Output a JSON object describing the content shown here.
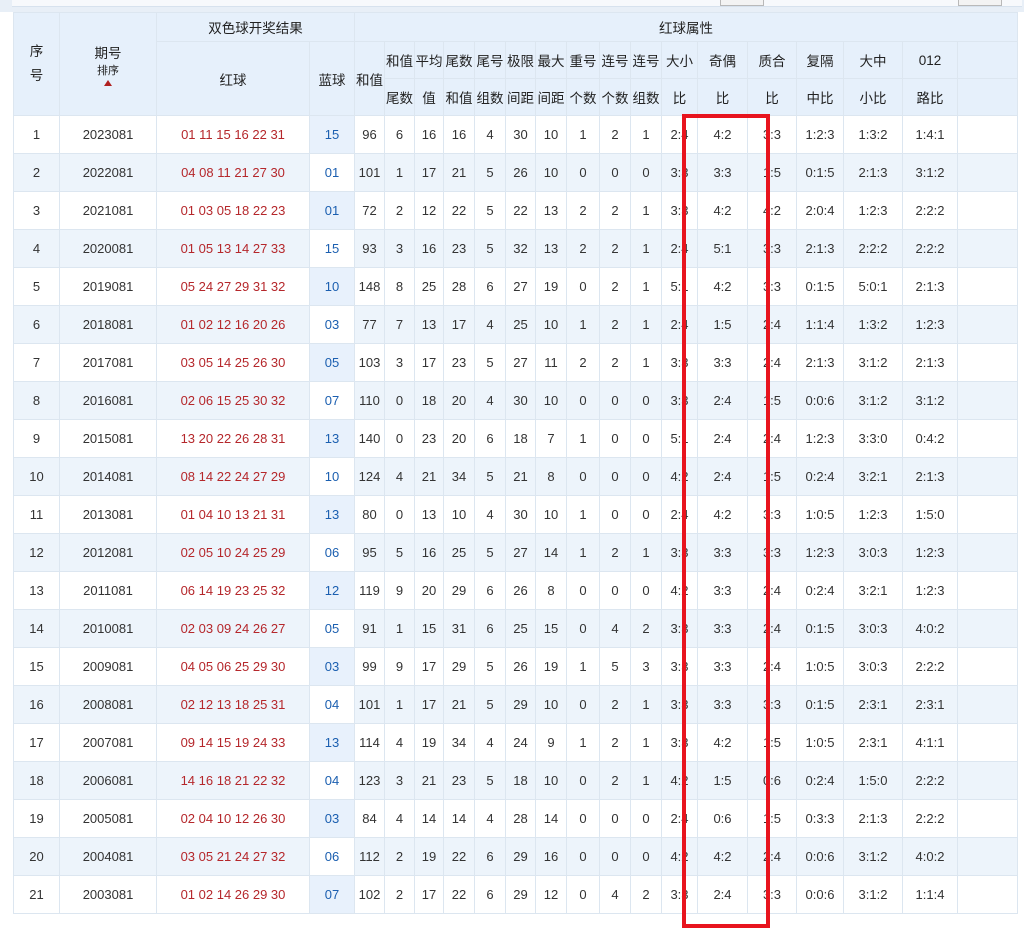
{
  "header": {
    "seq": "序号",
    "period": "期号",
    "sort": "排序",
    "result_group": "双色球开奖结果",
    "red_group": "红球属性",
    "red": "红球",
    "blue": "蓝球",
    "cols": [
      "和值",
      "和值尾数",
      "平均值",
      "尾数和值",
      "尾号组数",
      "极限间距",
      "最大间距",
      "重号个数",
      "连号个数",
      "连号组数",
      "大小比",
      "奇偶比",
      "质合比",
      "复隔中比",
      "大中小比",
      "012路比"
    ]
  },
  "rows": [
    [
      "1",
      "2023081",
      "01 11 15 16 22 31",
      "15",
      "96",
      "6",
      "16",
      "16",
      "4",
      "30",
      "10",
      "1",
      "2",
      "1",
      "2:4",
      "4:2",
      "3:3",
      "1:2:3",
      "1:3:2",
      "1:4:1"
    ],
    [
      "2",
      "2022081",
      "04 08 11 21 27 30",
      "01",
      "101",
      "1",
      "17",
      "21",
      "5",
      "26",
      "10",
      "0",
      "0",
      "0",
      "3:3",
      "3:3",
      "1:5",
      "0:1:5",
      "2:1:3",
      "3:1:2"
    ],
    [
      "3",
      "2021081",
      "01 03 05 18 22 23",
      "01",
      "72",
      "2",
      "12",
      "22",
      "5",
      "22",
      "13",
      "2",
      "2",
      "1",
      "3:3",
      "4:2",
      "4:2",
      "2:0:4",
      "1:2:3",
      "2:2:2"
    ],
    [
      "4",
      "2020081",
      "01 05 13 14 27 33",
      "15",
      "93",
      "3",
      "16",
      "23",
      "5",
      "32",
      "13",
      "2",
      "2",
      "1",
      "2:4",
      "5:1",
      "3:3",
      "2:1:3",
      "2:2:2",
      "2:2:2"
    ],
    [
      "5",
      "2019081",
      "05 24 27 29 31 32",
      "10",
      "148",
      "8",
      "25",
      "28",
      "6",
      "27",
      "19",
      "0",
      "2",
      "1",
      "5:1",
      "4:2",
      "3:3",
      "0:1:5",
      "5:0:1",
      "2:1:3"
    ],
    [
      "6",
      "2018081",
      "01 02 12 16 20 26",
      "03",
      "77",
      "7",
      "13",
      "17",
      "4",
      "25",
      "10",
      "1",
      "2",
      "1",
      "2:4",
      "1:5",
      "2:4",
      "1:1:4",
      "1:3:2",
      "1:2:3"
    ],
    [
      "7",
      "2017081",
      "03 05 14 25 26 30",
      "05",
      "103",
      "3",
      "17",
      "23",
      "5",
      "27",
      "11",
      "2",
      "2",
      "1",
      "3:3",
      "3:3",
      "2:4",
      "2:1:3",
      "3:1:2",
      "2:1:3"
    ],
    [
      "8",
      "2016081",
      "02 06 15 25 30 32",
      "07",
      "110",
      "0",
      "18",
      "20",
      "4",
      "30",
      "10",
      "0",
      "0",
      "0",
      "3:3",
      "2:4",
      "1:5",
      "0:0:6",
      "3:1:2",
      "3:1:2"
    ],
    [
      "9",
      "2015081",
      "13 20 22 26 28 31",
      "13",
      "140",
      "0",
      "23",
      "20",
      "6",
      "18",
      "7",
      "1",
      "0",
      "0",
      "5:1",
      "2:4",
      "2:4",
      "1:2:3",
      "3:3:0",
      "0:4:2"
    ],
    [
      "10",
      "2014081",
      "08 14 22 24 27 29",
      "10",
      "124",
      "4",
      "21",
      "34",
      "5",
      "21",
      "8",
      "0",
      "0",
      "0",
      "4:2",
      "2:4",
      "1:5",
      "0:2:4",
      "3:2:1",
      "2:1:3"
    ],
    [
      "11",
      "2013081",
      "01 04 10 13 21 31",
      "13",
      "80",
      "0",
      "13",
      "10",
      "4",
      "30",
      "10",
      "1",
      "0",
      "0",
      "2:4",
      "4:2",
      "3:3",
      "1:0:5",
      "1:2:3",
      "1:5:0"
    ],
    [
      "12",
      "2012081",
      "02 05 10 24 25 29",
      "06",
      "95",
      "5",
      "16",
      "25",
      "5",
      "27",
      "14",
      "1",
      "2",
      "1",
      "3:3",
      "3:3",
      "3:3",
      "1:2:3",
      "3:0:3",
      "1:2:3"
    ],
    [
      "13",
      "2011081",
      "06 14 19 23 25 32",
      "12",
      "119",
      "9",
      "20",
      "29",
      "6",
      "26",
      "8",
      "0",
      "0",
      "0",
      "4:2",
      "3:3",
      "2:4",
      "0:2:4",
      "3:2:1",
      "1:2:3"
    ],
    [
      "14",
      "2010081",
      "02 03 09 24 26 27",
      "05",
      "91",
      "1",
      "15",
      "31",
      "6",
      "25",
      "15",
      "0",
      "4",
      "2",
      "3:3",
      "3:3",
      "2:4",
      "0:1:5",
      "3:0:3",
      "4:0:2"
    ],
    [
      "15",
      "2009081",
      "04 05 06 25 29 30",
      "03",
      "99",
      "9",
      "17",
      "29",
      "5",
      "26",
      "19",
      "1",
      "5",
      "3",
      "3:3",
      "3:3",
      "2:4",
      "1:0:5",
      "3:0:3",
      "2:2:2"
    ],
    [
      "16",
      "2008081",
      "02 12 13 18 25 31",
      "04",
      "101",
      "1",
      "17",
      "21",
      "5",
      "29",
      "10",
      "0",
      "2",
      "1",
      "3:3",
      "3:3",
      "3:3",
      "0:1:5",
      "2:3:1",
      "2:3:1"
    ],
    [
      "17",
      "2007081",
      "09 14 15 19 24 33",
      "13",
      "114",
      "4",
      "19",
      "34",
      "4",
      "24",
      "9",
      "1",
      "2",
      "1",
      "3:3",
      "4:2",
      "1:5",
      "1:0:5",
      "2:3:1",
      "4:1:1"
    ],
    [
      "18",
      "2006081",
      "14 16 18 21 22 32",
      "04",
      "123",
      "3",
      "21",
      "23",
      "5",
      "18",
      "10",
      "0",
      "2",
      "1",
      "4:2",
      "1:5",
      "0:6",
      "0:2:4",
      "1:5:0",
      "2:2:2"
    ],
    [
      "19",
      "2005081",
      "02 04 10 12 26 30",
      "03",
      "84",
      "4",
      "14",
      "14",
      "4",
      "28",
      "14",
      "0",
      "0",
      "0",
      "2:4",
      "0:6",
      "1:5",
      "0:3:3",
      "2:1:3",
      "2:2:2"
    ],
    [
      "20",
      "2004081",
      "03 05 21 24 27 32",
      "06",
      "112",
      "2",
      "19",
      "22",
      "6",
      "29",
      "16",
      "0",
      "0",
      "0",
      "4:2",
      "4:2",
      "2:4",
      "0:0:6",
      "3:1:2",
      "4:0:2"
    ],
    [
      "21",
      "2003081",
      "01 02 14 26 29 30",
      "07",
      "102",
      "2",
      "17",
      "22",
      "6",
      "29",
      "12",
      "0",
      "4",
      "2",
      "3:3",
      "2:4",
      "3:3",
      "0:0:6",
      "3:1:2",
      "1:1:4"
    ]
  ],
  "colors": {
    "red_ball": "#b5272b",
    "blue_ball": "#1b5fb0",
    "highlight": "#e8141e",
    "header_bg": "#e6f0fb"
  }
}
